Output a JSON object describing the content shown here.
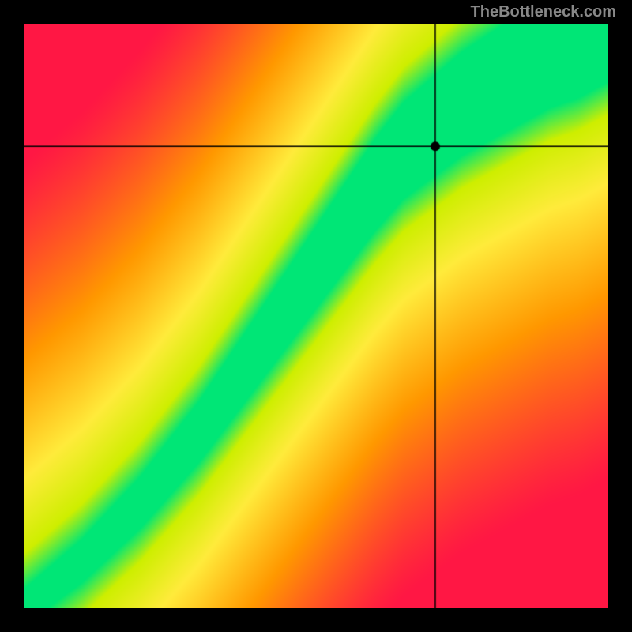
{
  "watermark": "TheBottleneck.com",
  "chart_data": {
    "type": "heatmap",
    "title": "",
    "xlabel": "",
    "ylabel": "",
    "xlim": [
      0,
      1
    ],
    "ylim": [
      0,
      1
    ],
    "crosshair": {
      "x": 0.705,
      "y": 0.79
    },
    "marker": {
      "x": 0.705,
      "y": 0.79
    },
    "optimal_curve": [
      {
        "x": 0.0,
        "y": 0.0
      },
      {
        "x": 0.1,
        "y": 0.08
      },
      {
        "x": 0.2,
        "y": 0.18
      },
      {
        "x": 0.3,
        "y": 0.3
      },
      {
        "x": 0.4,
        "y": 0.44
      },
      {
        "x": 0.5,
        "y": 0.58
      },
      {
        "x": 0.55,
        "y": 0.65
      },
      {
        "x": 0.6,
        "y": 0.72
      },
      {
        "x": 0.65,
        "y": 0.78
      },
      {
        "x": 0.7,
        "y": 0.82
      },
      {
        "x": 0.75,
        "y": 0.86
      },
      {
        "x": 0.8,
        "y": 0.89
      },
      {
        "x": 0.85,
        "y": 0.92
      },
      {
        "x": 0.9,
        "y": 0.95
      },
      {
        "x": 0.95,
        "y": 0.97
      },
      {
        "x": 1.0,
        "y": 1.0
      }
    ],
    "colorscale": [
      {
        "stop": 0.0,
        "color": "#ff1744"
      },
      {
        "stop": 0.4,
        "color": "#ff9800"
      },
      {
        "stop": 0.7,
        "color": "#ffeb3b"
      },
      {
        "stop": 0.9,
        "color": "#ceee00"
      },
      {
        "stop": 1.0,
        "color": "#00e676"
      }
    ],
    "band_width": 0.06
  }
}
